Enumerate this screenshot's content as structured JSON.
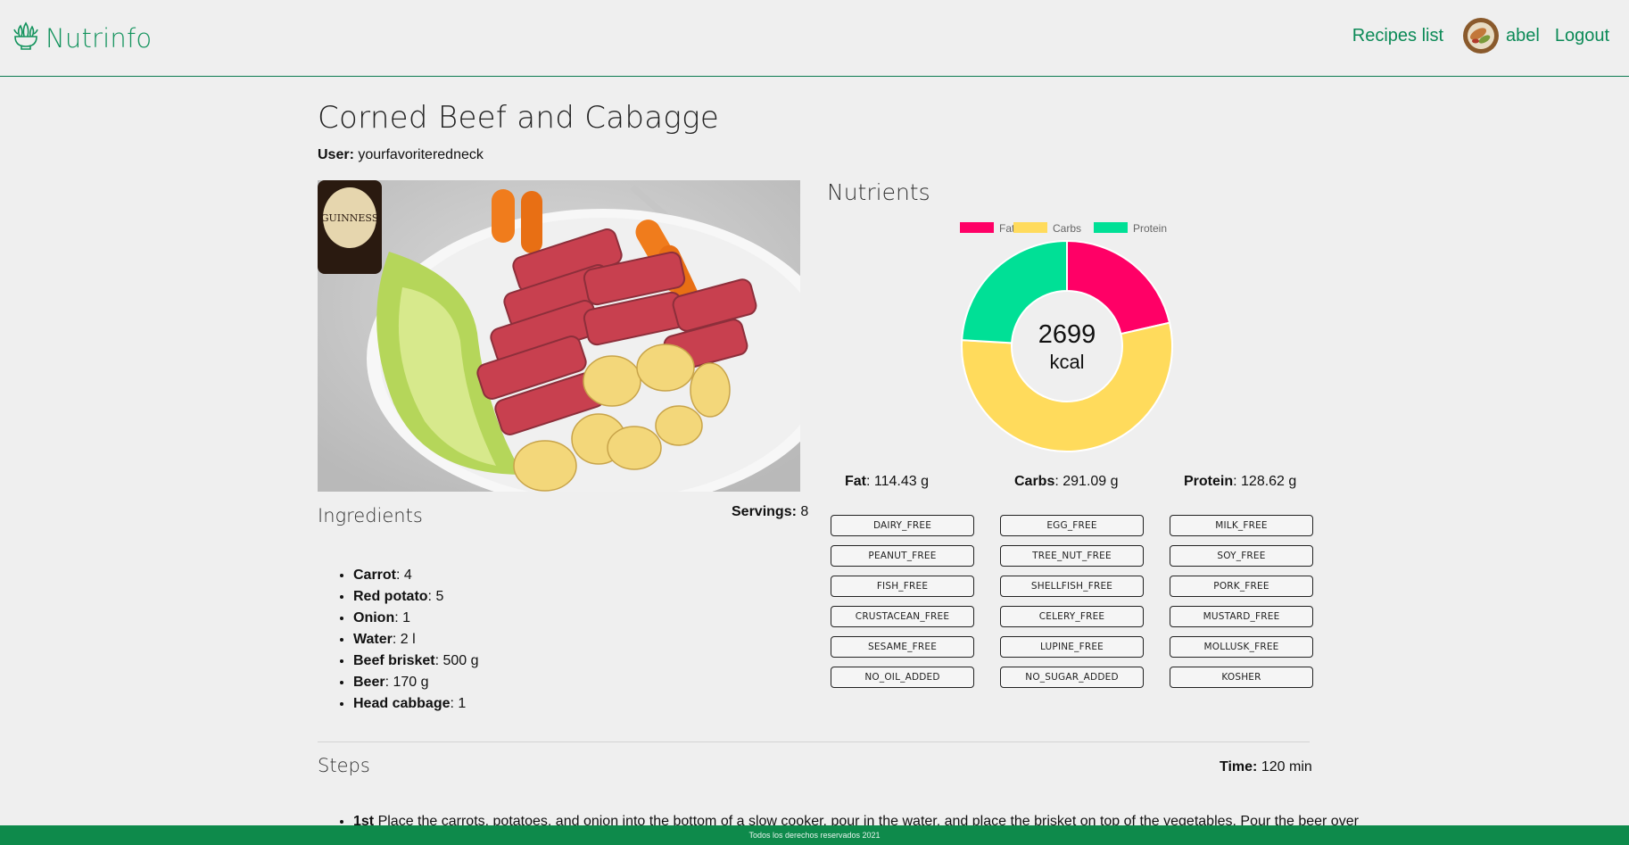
{
  "header": {
    "brand": "Nutrinfo",
    "nav": {
      "recipes": "Recipes list",
      "username": "abel",
      "logout": "Logout"
    }
  },
  "recipe": {
    "title": "Corned Beef and Cabagge",
    "user_label": "User:",
    "user": "yourfavoriteredneck",
    "ingredients_heading": "Ingredients",
    "servings_label": "Servings:",
    "servings": "8",
    "ingredients": [
      {
        "name": "Carrot",
        "qty": ": 4"
      },
      {
        "name": "Red potato",
        "qty": ": 5"
      },
      {
        "name": "Onion",
        "qty": ": 1"
      },
      {
        "name": "Water",
        "qty": ": 2 l"
      },
      {
        "name": "Beef brisket",
        "qty": ": 500 g"
      },
      {
        "name": "Beer",
        "qty": ": 170 g"
      },
      {
        "name": "Head cabbage",
        "qty": ": 1"
      }
    ],
    "steps_heading": "Steps",
    "time_label": "Time:",
    "time": "120 min",
    "steps": [
      {
        "ordinal": "1st",
        "text": "Place the carrots, potatoes, and onion into the bottom of a slow cooker, pour in the water, and place the brisket on top of the vegetables. Pour the beer over"
      }
    ]
  },
  "nutrients": {
    "heading": "Nutrients",
    "kcal_value": "2699",
    "kcal_unit": "kcal",
    "fat_label": "Fat",
    "fat_value": ": 114.43 g",
    "carbs_label": "Carbs",
    "carbs_value": ": 291.09 g",
    "protein_label": "Protein",
    "protein_value": ": 128.62 g"
  },
  "tags": [
    "DAIRY_FREE",
    "EGG_FREE",
    "MILK_FREE",
    "PEANUT_FREE",
    "TREE_NUT_FREE",
    "SOY_FREE",
    "FISH_FREE",
    "SHELLFISH_FREE",
    "PORK_FREE",
    "CRUSTACEAN_FREE",
    "CELERY_FREE",
    "MUSTARD_FREE",
    "SESAME_FREE",
    "LUPINE_FREE",
    "MOLLUSK_FREE",
    "NO_OIL_ADDED",
    "NO_SUGAR_ADDED",
    "KOSHER"
  ],
  "chart_data": {
    "type": "pie",
    "donut": true,
    "categories": [
      "Fat",
      "Carbs",
      "Protein"
    ],
    "values": [
      114.43,
      291.09,
      128.62
    ],
    "colors": [
      "#ff0066",
      "#ffdb5c",
      "#00e096"
    ],
    "legend": "top",
    "center_text": "2699 kcal"
  },
  "footer": {
    "text": "Todos los derechos reservados 2021"
  }
}
